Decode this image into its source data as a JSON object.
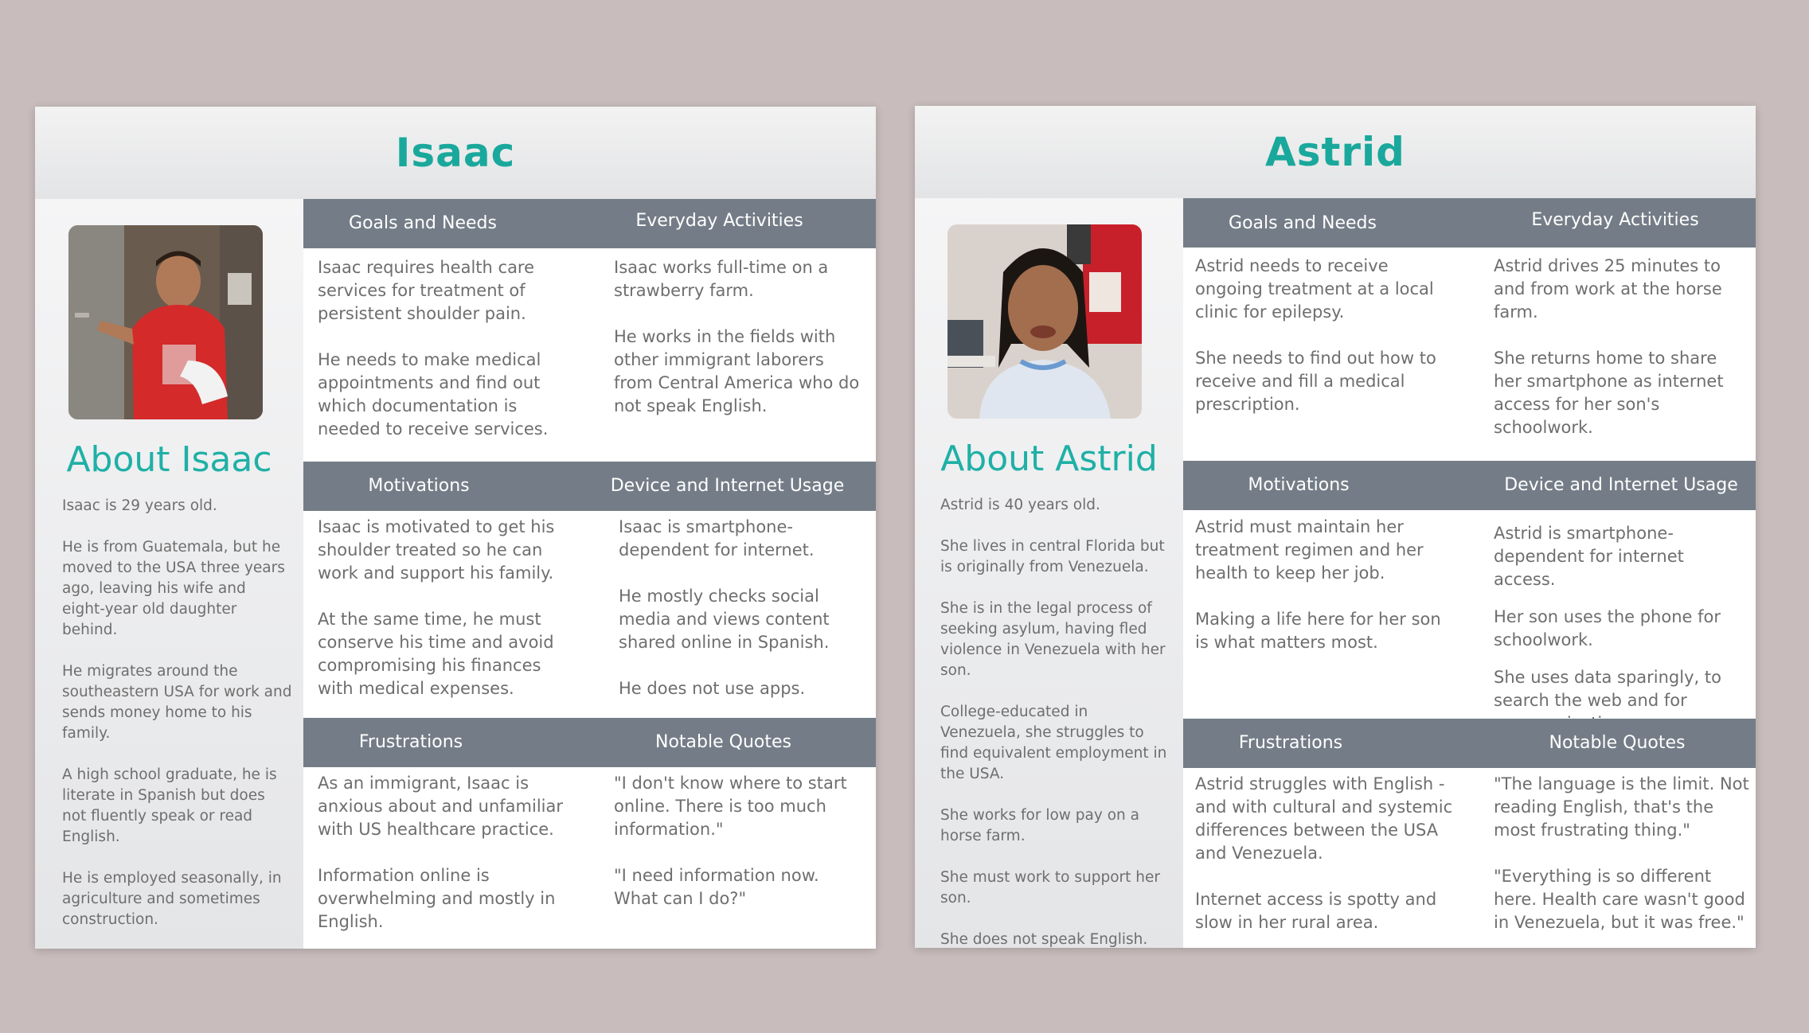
{
  "personas": [
    {
      "name": "Isaac",
      "about_title": "About Isaac",
      "about": [
        "Isaac is 29 years old.",
        "He is from Guatemala, but he moved to the USA three years ago, leaving his wife and eight-year old daughter behind.",
        "He migrates around the southeastern USA for work and sends money home to his family.",
        "A high school graduate, he is literate in Spanish but does not fluently speak or read English.",
        "He is employed seasonally, in agriculture and sometimes construction."
      ],
      "sections": {
        "goals": {
          "title": "Goals and Needs",
          "paragraphs": [
            "Isaac requires health care services for treatment of persistent shoulder pain.",
            "He needs to make medical appointments and find out which documentation is needed to receive services."
          ]
        },
        "activities": {
          "title": "Everyday Activities",
          "paragraphs": [
            "Isaac works full-time on a strawberry farm.",
            "He works in the fields with other immigrant laborers from Central America who do not speak English."
          ]
        },
        "motivations": {
          "title": "Motivations",
          "paragraphs": [
            "Isaac is motivated to get his shoulder treated so he can work and support his family.",
            "At the same time, he must conserve his time and avoid compromising his finances with medical expenses."
          ]
        },
        "device": {
          "title": "Device and Internet Usage",
          "paragraphs": [
            "Isaac is smartphone-dependent for internet.",
            "He mostly checks social media and views content shared online in Spanish.",
            "He does not use apps."
          ]
        },
        "frustrations": {
          "title": "Frustrations",
          "paragraphs": [
            "As an immigrant, Isaac is anxious about and unfamiliar with US healthcare practice.",
            "Information online is overwhelming and mostly in English."
          ]
        },
        "quotes": {
          "title": "Notable Quotes",
          "paragraphs": [
            "\"I don't know where to start online. There is too much information.\"",
            "\"I need information now. What can I do?\""
          ]
        }
      }
    },
    {
      "name": "Astrid",
      "about_title": "About Astrid",
      "about": [
        "Astrid is 40 years old.",
        "She lives in central Florida but is originally from Venezuela.",
        "She is in the legal process of seeking asylum, having fled violence in Venezuela with her son.",
        "College-educated in Venezuela, she struggles to find equivalent employment in the USA.",
        "She works for low pay on a horse farm.",
        "She must work to support her son.",
        "She does not speak English."
      ],
      "sections": {
        "goals": {
          "title": "Goals and Needs",
          "paragraphs": [
            "Astrid needs to receive ongoing treatment at a local clinic for epilepsy.",
            "She needs to find out how to receive and fill a medical prescription."
          ]
        },
        "activities": {
          "title": "Everyday Activities",
          "paragraphs": [
            "Astrid drives 25 minutes to and from work at the horse farm.",
            "She returns home to share her smartphone as internet access for her son's schoolwork."
          ]
        },
        "motivations": {
          "title": "Motivations",
          "paragraphs": [
            "Astrid must maintain her treatment regimen and her health to keep her job.",
            "Making a life here for her son is what matters most."
          ]
        },
        "device": {
          "title": "Device and Internet Usage",
          "paragraphs": [
            "Astrid is smartphone-dependent for internet access.",
            "Her son uses the phone for schoolwork.",
            "She uses data sparingly, to search the web and for communication."
          ]
        },
        "frustrations": {
          "title": "Frustrations",
          "paragraphs": [
            "Astrid struggles with English - and with cultural and systemic differences between the USA and Venezuela.",
            "Internet access is spotty and slow in her rural area."
          ]
        },
        "quotes": {
          "title": "Notable Quotes",
          "paragraphs": [
            "\"The language is the limit. Not reading English, that's the most frustrating thing.\"",
            "\"Everything is so different here. Health care wasn't good in Venezuela, but it was free.\""
          ]
        }
      }
    }
  ],
  "colors": {
    "accent": "#1aa89c",
    "bar": "#747d87",
    "background": "#c8bcbc"
  }
}
